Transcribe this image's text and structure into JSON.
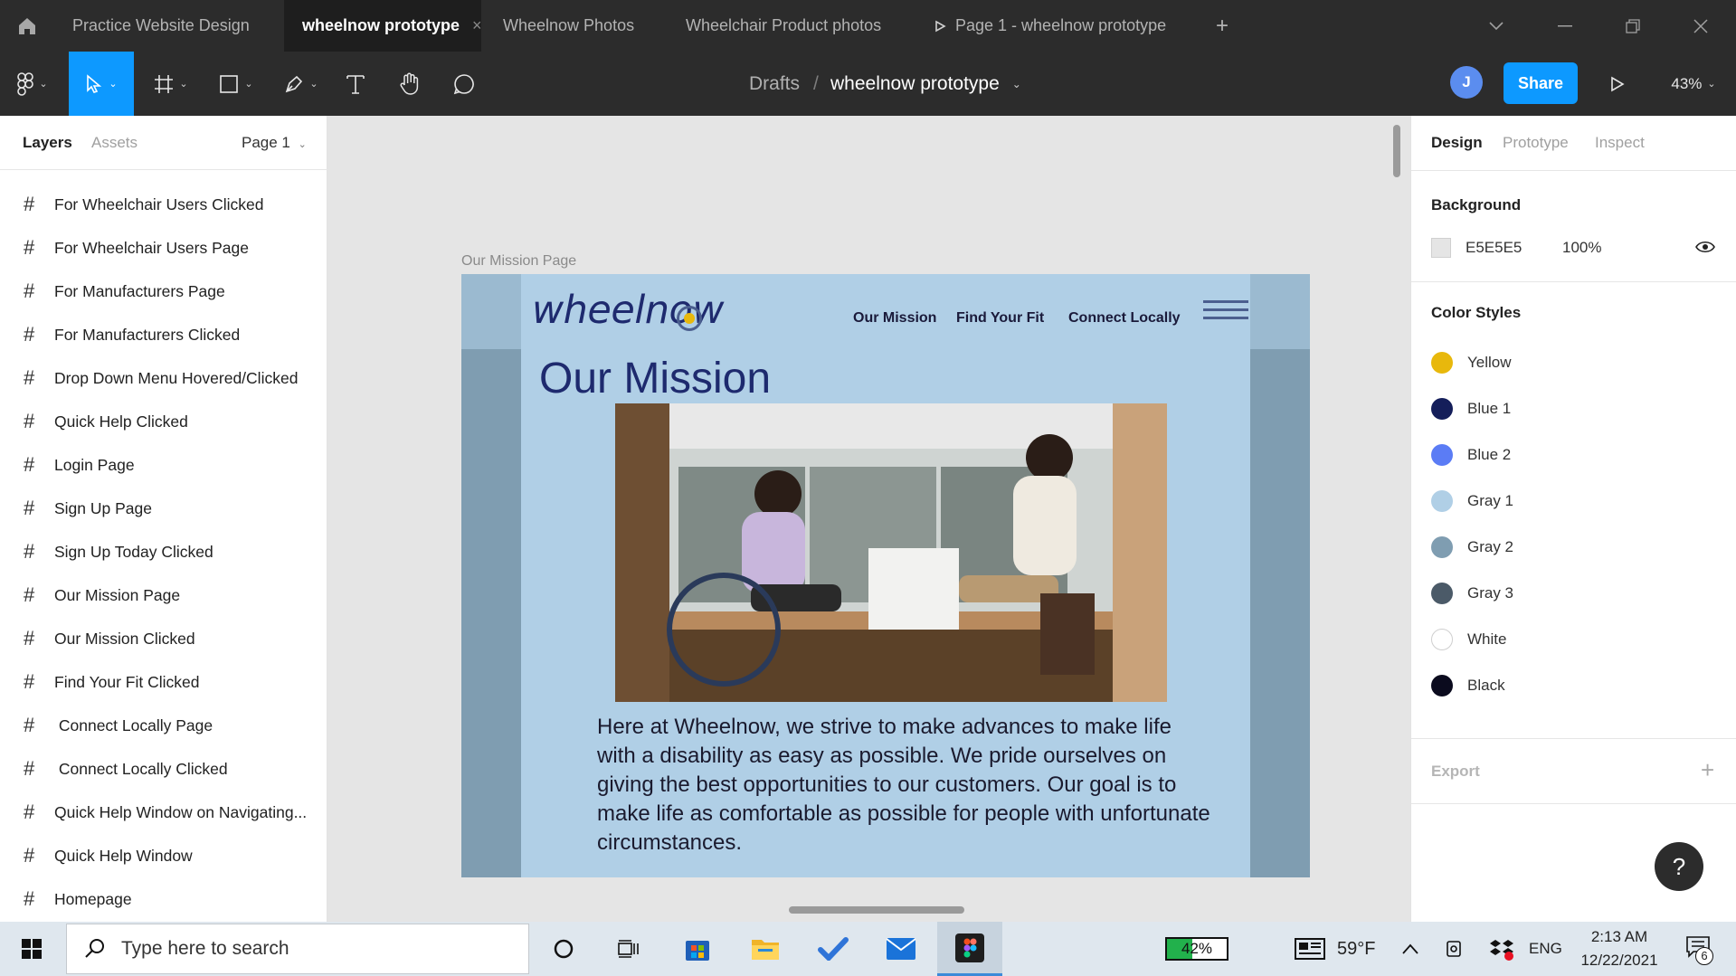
{
  "titlebar": {
    "tabs": [
      "Practice Website Design",
      "wheelnow prototype",
      "Wheelnow Photos",
      "Wheelchair Product photos",
      "Page 1 - wheelnow prototype"
    ],
    "active_tab_close": "×",
    "new_tab": "+"
  },
  "toolbar": {
    "breadcrumb_parent": "Drafts",
    "breadcrumb_sep": "/",
    "file_name": "wheelnow prototype",
    "avatar_initial": "J",
    "share_label": "Share",
    "zoom": "43%"
  },
  "left_panel": {
    "tab_layers": "Layers",
    "tab_assets": "Assets",
    "page_select": "Page 1",
    "layers": [
      "For Wheelchair Users Clicked",
      "For Wheelchair Users Page",
      "For Manufacturers Page",
      "For Manufacturers Clicked",
      "Drop Down Menu Hovered/Clicked",
      "Quick Help Clicked",
      "Login Page",
      "Sign Up Page",
      "Sign Up Today Clicked",
      "Our Mission Page",
      "Our Mission Clicked",
      "Find Your Fit Clicked",
      " Connect Locally Page",
      " Connect Locally Clicked",
      "Quick Help Window on Navigating...",
      "Quick Help Window",
      "Homepage"
    ]
  },
  "canvas": {
    "frame_label": "Our Mission Page",
    "logo_text": "wheelnow",
    "nav": [
      "Our Mission",
      "Find Your Fit",
      "Connect Locally"
    ],
    "title": "Our Mission",
    "body_text": "Here at Wheelnow, we strive to make advances to make life with a disability as easy as possible. We pride ourselves on giving the best opportunities to our customers. Our goal is to make life as comfortable as possible for people with unfortunate circumstances."
  },
  "right_panel": {
    "tabs": [
      "Design",
      "Prototype",
      "Inspect"
    ],
    "background_heading": "Background",
    "background_hex": "E5E5E5",
    "background_opacity": "100%",
    "color_styles_heading": "Color Styles",
    "color_styles": [
      {
        "name": "Yellow",
        "color": "#e8b80c"
      },
      {
        "name": "Blue 1",
        "color": "#141e5a"
      },
      {
        "name": "Blue 2",
        "color": "#5b7cf5"
      },
      {
        "name": "Gray 1",
        "color": "#b0cfe6"
      },
      {
        "name": "Gray 2",
        "color": "#7f9db1"
      },
      {
        "name": "Gray 3",
        "color": "#4b5a68"
      },
      {
        "name": "White",
        "color": "#ffffff"
      },
      {
        "name": "Black",
        "color": "#0b0b1e"
      }
    ],
    "export_heading": "Export",
    "export_add": "+",
    "help": "?"
  },
  "taskbar": {
    "search_placeholder": "Type here to search",
    "battery": "42%",
    "weather": "59°F",
    "language": "ENG",
    "time": "2:13 AM",
    "date": "12/22/2021",
    "notification_count": "6"
  },
  "colors": {
    "accent": "#0d99ff",
    "frame_bg": "#b0cfe6",
    "gutter": "#7f9db1",
    "brand_navy": "#1e2a6e"
  }
}
